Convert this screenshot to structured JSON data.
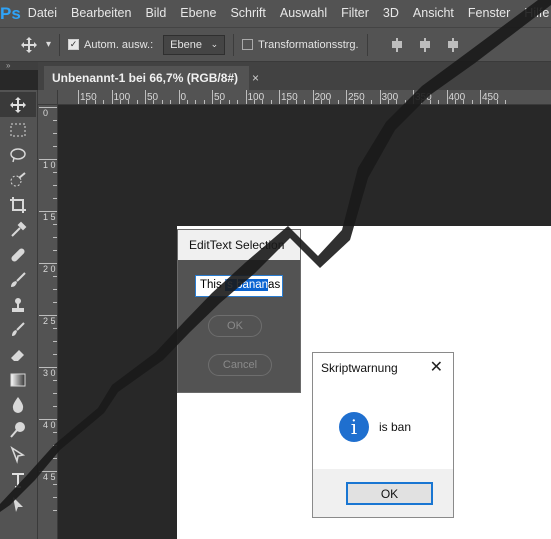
{
  "app": {
    "logo": "Ps"
  },
  "menu": [
    "Datei",
    "Bearbeiten",
    "Bild",
    "Ebene",
    "Schrift",
    "Auswahl",
    "Filter",
    "3D",
    "Ansicht",
    "Fenster",
    "Hilfe"
  ],
  "options": {
    "auto_select_label": "Autom. ausw.:",
    "auto_select_checked": true,
    "target_value": "Ebene",
    "transform_label": "Transformationsstrg.",
    "transform_checked": false
  },
  "panel_strip_mark": "»",
  "doc_tab": {
    "title": "Unbenannt-1 bei 66,7% (RGB/8#)",
    "close": "×"
  },
  "ruler_h_labels": [
    "150",
    "100",
    "50",
    "0",
    "50",
    "100",
    "150",
    "200",
    "250",
    "300",
    "350",
    "400",
    "450"
  ],
  "ruler_v_labels": [
    "0",
    "1 0 0",
    "1 5 0",
    "2 0 0",
    "2 5 0",
    "3 0 0",
    "4 0 0",
    "4 5 0"
  ],
  "tools": [
    "move-icon",
    "marquee-icon",
    "lasso-icon",
    "quick-select-icon",
    "crop-icon",
    "eyedropper-icon",
    "healing-icon",
    "brush-icon",
    "stamp-icon",
    "history-brush-icon",
    "eraser-icon",
    "gradient-icon",
    "blur-icon",
    "dodge-icon",
    "pen-icon",
    "type-icon",
    "path-select-icon"
  ],
  "edit_dialog": {
    "title": "EditText Selection",
    "text_before": "This ",
    "text_selected": "'s banan",
    "text_after": "as !",
    "ok_label": "OK",
    "cancel_label": "Cancel"
  },
  "warning_dialog": {
    "title": "Skriptwarnung",
    "close": "✕",
    "icon": "i",
    "message": "is ban",
    "ok_label": "OK"
  },
  "colors": {
    "chrome": "#535353",
    "canvas_bg": "#282828",
    "accent": "#0a64d2",
    "ps_logo": "#2fa3f7",
    "info_icon": "#1f6fcf"
  }
}
